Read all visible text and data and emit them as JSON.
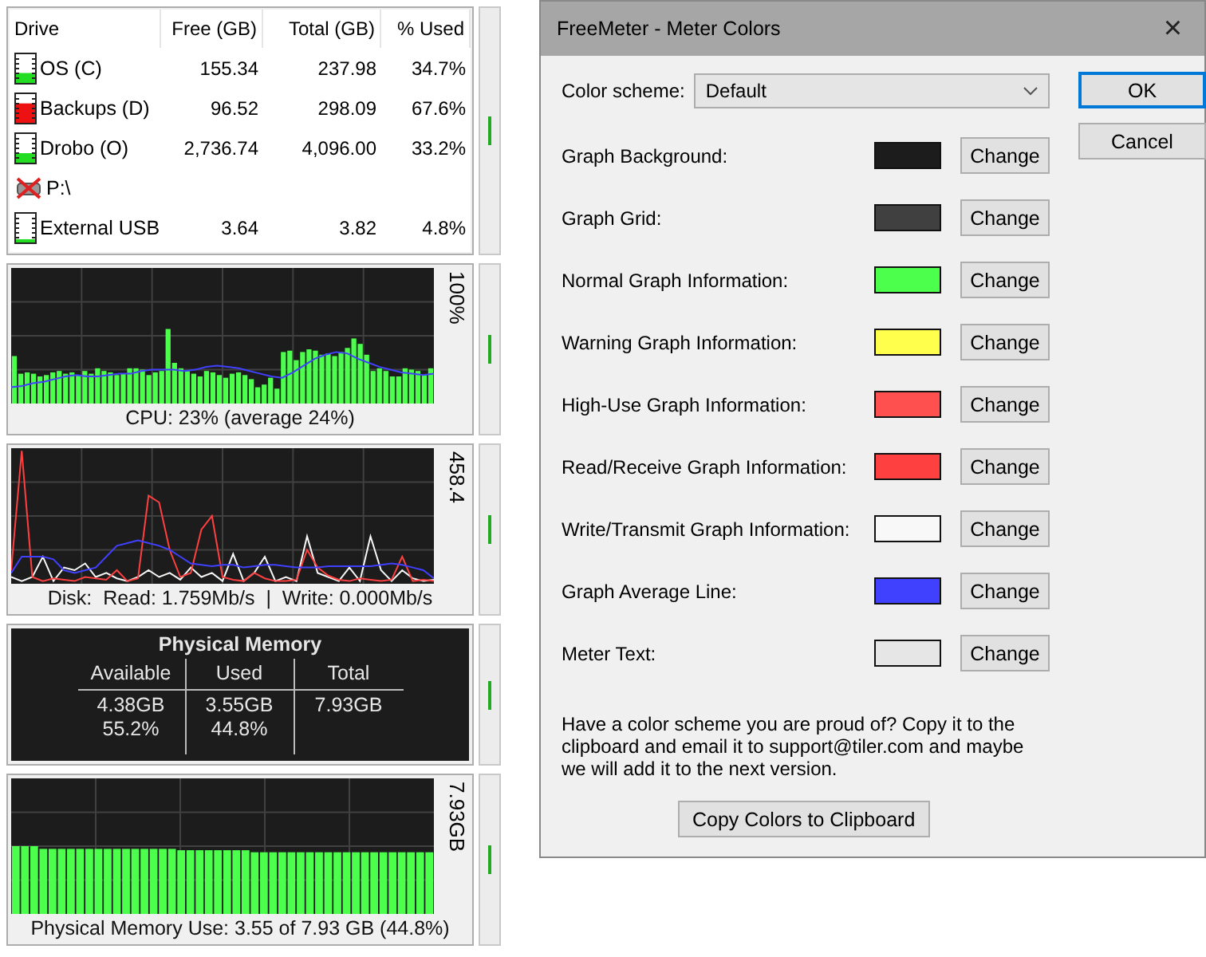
{
  "drives": {
    "columns": [
      "Drive",
      "Free (GB)",
      "Total (GB)",
      "% Used"
    ],
    "rows": [
      {
        "kind": "disk",
        "name": "OS (C)",
        "free": "155.34",
        "total": "237.98",
        "used": "34.7%",
        "level": 0.347,
        "color": "#22dd22"
      },
      {
        "kind": "disk",
        "name": "Backups (D)",
        "free": "96.52",
        "total": "298.09",
        "used": "67.6%",
        "level": 0.676,
        "color": "#ee1111"
      },
      {
        "kind": "disk",
        "name": "Drobo (O)",
        "free": "2,736.74",
        "total": "4,096.00",
        "used": "33.2%",
        "level": 0.332,
        "color": "#22dd22"
      },
      {
        "kind": "disconnected",
        "name": "P:\\"
      },
      {
        "kind": "disk",
        "name": "External USB",
        "free": "3.64",
        "total": "3.82",
        "used": "4.8%",
        "level": 0.048,
        "color": "#22dd22"
      }
    ]
  },
  "cpu": {
    "scale": "100%",
    "caption": "CPU: 23% (average 24%)"
  },
  "disk": {
    "scale": "458.4",
    "caption": "Disk:  Read: 1.759Mb/s  |  Write: 0.000Mb/s"
  },
  "memory": {
    "title": "Physical Memory",
    "columns": [
      "Available",
      "Used",
      "Total"
    ],
    "values": [
      [
        "4.38GB",
        "55.2%"
      ],
      [
        "3.55GB",
        "44.8%"
      ],
      [
        "7.93GB"
      ]
    ]
  },
  "memory_graph": {
    "scale": "7.93GB",
    "caption": "Physical Memory Use: 3.55 of 7.93 GB (44.8%)"
  },
  "dialog": {
    "title": "FreeMeter - Meter Colors",
    "close": "×",
    "scheme_label": "Color scheme:",
    "scheme": "Default",
    "colors": [
      {
        "label": "Graph Background:",
        "color": "#1c1c1c",
        "button": "Change"
      },
      {
        "label": "Graph Grid:",
        "color": "#404040",
        "button": "Change"
      },
      {
        "label": "Normal Graph Information:",
        "color": "#4cff4c",
        "button": "Change"
      },
      {
        "label": "Warning Graph Information:",
        "color": "#ffff4c",
        "button": "Change"
      },
      {
        "label": "High-Use Graph Information:",
        "color": "#ff5050",
        "button": "Change"
      },
      {
        "label": "Read/Receive Graph Information:",
        "color": "#ff4040",
        "button": "Change"
      },
      {
        "label": "Write/Transmit Graph Information:",
        "color": "#f8f8f8",
        "button": "Change"
      },
      {
        "label": "Graph Average Line:",
        "color": "#4040ff",
        "button": "Change"
      },
      {
        "label": "Meter Text:",
        "color": "#e6e6e6",
        "button": "Change"
      }
    ],
    "note": "Have a color scheme you are proud of? Copy it to the clipboard and email it to support@tiler.com and maybe we will add it to the next version.",
    "copy_button": "Copy Colors to Clipboard",
    "buttons": [
      {
        "label": "OK",
        "selected": true
      },
      {
        "label": "Cancel",
        "selected": false
      }
    ]
  }
}
